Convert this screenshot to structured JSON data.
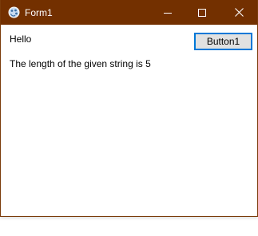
{
  "window": {
    "title": "Form1",
    "app_icon": "form-app-icon",
    "titlebar_color": "#733000",
    "border_color": "#7a3b0a",
    "controls": {
      "minimize_icon": "minimize-icon",
      "maximize_icon": "maximize-icon",
      "close_icon": "close-icon"
    }
  },
  "form": {
    "label1_text": "Hello",
    "label2_text": "The length of the given string is 5",
    "button1_label": "Button1",
    "button_focus_color": "#0078d7"
  }
}
